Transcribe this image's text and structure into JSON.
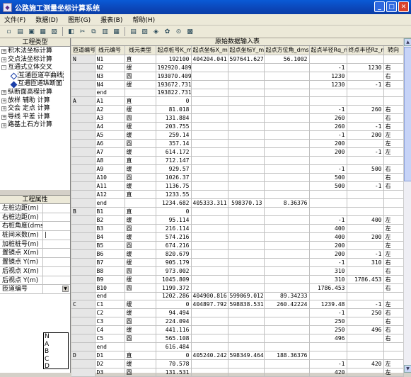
{
  "window": {
    "title": "公路施工测量坐标计算系统"
  },
  "menu": [
    "文件(F)",
    "数据(D)",
    "图形(G)",
    "报表(B)",
    "帮助(H)"
  ],
  "toolbar_icons": [
    "new-icon",
    "open-icon",
    "save-icon",
    "save-as-icon",
    "print-icon",
    "preview-icon",
    "cut-icon",
    "copy-icon",
    "paste-icon",
    "grid-icon",
    "table-icon",
    "chart-icon",
    "export-icon",
    "settings-icon",
    "info-icon",
    "calc-icon"
  ],
  "left": {
    "tree_header": "工程类型",
    "tree": [
      {
        "label": "积木法坐标计算",
        "exp": "+",
        "level": 0
      },
      {
        "label": "交点法坐标计算",
        "exp": "+",
        "level": 0
      },
      {
        "label": "互通式立体交叉",
        "exp": "-",
        "level": 0
      },
      {
        "label": "互通匝道平曲线",
        "exp": "",
        "level": 1,
        "sel": true
      },
      {
        "label": "互通匝道纵断面",
        "exp": "",
        "level": 1
      },
      {
        "label": "纵断面高程计算",
        "exp": "+",
        "level": 0
      },
      {
        "label": "放样 辅助 计算",
        "exp": "+",
        "level": 0
      },
      {
        "label": "交会 定点 计算",
        "exp": "+",
        "level": 0
      },
      {
        "label": "导线 平差 计算",
        "exp": "+",
        "level": 0
      },
      {
        "label": "路基土石方计算",
        "exp": "+",
        "level": 0
      }
    ],
    "props_header": "工程属性",
    "props": [
      {
        "name": "左桩边距(m)",
        "value": ""
      },
      {
        "name": "右桩边距(m)",
        "value": ""
      },
      {
        "name": "右桩角度(dms)",
        "value": ""
      },
      {
        "name": "桩间米数(m)",
        "value": "|"
      },
      {
        "name": "加桩桩号(m)",
        "value": ""
      },
      {
        "name": "置镜点 X(m)",
        "value": ""
      },
      {
        "name": "置镜点 Y(m)",
        "value": ""
      },
      {
        "name": "后视点 X(m)",
        "value": ""
      },
      {
        "name": "后视点 Y(m)",
        "value": ""
      },
      {
        "name": "匝道编号",
        "value": ""
      }
    ],
    "dropdown_options": [
      "N",
      "A",
      "B",
      "C",
      "D"
    ]
  },
  "table": {
    "title": "原始数据输入表",
    "columns": [
      "匝道编号",
      "线元编号",
      "线元类型",
      "起点桩号K_m",
      "起点坐标X_m",
      "起点坐标Y_m",
      "起点方位角_dms",
      "起点半径Rq_m",
      "终点半径Rz_m",
      "转向"
    ],
    "rows": [
      [
        "N",
        "N1",
        "直",
        "192100",
        "404204.041",
        "597641.627",
        "56.1002",
        "",
        "",
        ""
      ],
      [
        "",
        "N2",
        "缓",
        "192920.409",
        "",
        "",
        "",
        "-1",
        "1230",
        "右"
      ],
      [
        "",
        "N3",
        "圆",
        "193070.409",
        "",
        "",
        "",
        "1230",
        "",
        "右"
      ],
      [
        "",
        "N4",
        "缓",
        "193672.731",
        "",
        "",
        "",
        "1230",
        "-1",
        "右"
      ],
      [
        "",
        "end",
        "",
        "193822.731",
        "",
        "",
        "",
        "",
        "",
        ""
      ],
      [
        "A",
        "A1",
        "直",
        "0",
        "",
        "",
        "",
        "",
        "",
        ""
      ],
      [
        "",
        "A2",
        "缓",
        "81.018",
        "",
        "",
        "",
        "-1",
        "260",
        "右"
      ],
      [
        "",
        "A3",
        "圆",
        "131.884",
        "",
        "",
        "",
        "260",
        "",
        "右"
      ],
      [
        "",
        "A4",
        "缓",
        "203.755",
        "",
        "",
        "",
        "260",
        "-1",
        "右"
      ],
      [
        "",
        "A5",
        "缓",
        "259.14",
        "",
        "",
        "",
        "-1",
        "200",
        "左"
      ],
      [
        "",
        "A6",
        "圆",
        "357.14",
        "",
        "",
        "",
        "200",
        "",
        "左"
      ],
      [
        "",
        "A7",
        "缓",
        "614.172",
        "",
        "",
        "",
        "200",
        "-1",
        "左"
      ],
      [
        "",
        "A8",
        "直",
        "712.147",
        "",
        "",
        "",
        "",
        "",
        ""
      ],
      [
        "",
        "A9",
        "缓",
        "929.57",
        "",
        "",
        "",
        "-1",
        "500",
        "右"
      ],
      [
        "",
        "A10",
        "圆",
        "1026.37",
        "",
        "",
        "",
        "500",
        "",
        "右"
      ],
      [
        "",
        "A11",
        "缓",
        "1136.75",
        "",
        "",
        "",
        "500",
        "-1",
        "右"
      ],
      [
        "",
        "A12",
        "直",
        "1233.55",
        "",
        "",
        "",
        "",
        "",
        ""
      ],
      [
        "",
        "end",
        "",
        "1234.682",
        "405333.311",
        "598370.13",
        "8.36376",
        "",
        "",
        ""
      ],
      [
        "B",
        "B1",
        "直",
        "0",
        "",
        "",
        "",
        "",
        "",
        ""
      ],
      [
        "",
        "B2",
        "缓",
        "95.114",
        "",
        "",
        "",
        "-1",
        "400",
        "左"
      ],
      [
        "",
        "B3",
        "圆",
        "216.114",
        "",
        "",
        "",
        "400",
        "",
        "左"
      ],
      [
        "",
        "B4",
        "缓",
        "574.216",
        "",
        "",
        "",
        "400",
        "200",
        "左"
      ],
      [
        "",
        "B5",
        "圆",
        "674.216",
        "",
        "",
        "",
        "200",
        "",
        "左"
      ],
      [
        "",
        "B6",
        "缓",
        "820.679",
        "",
        "",
        "",
        "200",
        "-1",
        "左"
      ],
      [
        "",
        "B7",
        "缓",
        "905.179",
        "",
        "",
        "",
        "-1",
        "310",
        "右"
      ],
      [
        "",
        "B8",
        "圆",
        "973.002",
        "",
        "",
        "",
        "310",
        "",
        "右"
      ],
      [
        "",
        "B9",
        "缓",
        "1045.809",
        "",
        "",
        "",
        "310",
        "1786.453",
        "右"
      ],
      [
        "",
        "B10",
        "圆",
        "1199.372",
        "",
        "",
        "",
        "1786.453",
        "",
        "右"
      ],
      [
        "",
        "end",
        "",
        "1202.286",
        "404900.816",
        "599069.012",
        "89.34233",
        "",
        "",
        ""
      ],
      [
        "C",
        "C1",
        "缓",
        "0",
        "404897.792",
        "598838.531",
        "260.42224",
        "1239.48",
        "-1",
        "左"
      ],
      [
        "",
        "C2",
        "缓",
        "94.494",
        "",
        "",
        "",
        "-1",
        "250",
        "右"
      ],
      [
        "",
        "C3",
        "圆",
        "224.094",
        "",
        "",
        "",
        "250",
        "",
        "右"
      ],
      [
        "",
        "C4",
        "缓",
        "441.116",
        "",
        "",
        "",
        "250",
        "496",
        "右"
      ],
      [
        "",
        "C5",
        "圆",
        "565.108",
        "",
        "",
        "",
        "496",
        "",
        "右"
      ],
      [
        "",
        "end",
        "",
        "616.484",
        "",
        "",
        "",
        "",
        "",
        ""
      ],
      [
        "D",
        "D1",
        "直",
        "0",
        "405240.242",
        "598349.464",
        "188.36376",
        "",
        "",
        ""
      ],
      [
        "",
        "D2",
        "缓",
        "70.578",
        "",
        "",
        "",
        "-1",
        "420",
        "左"
      ],
      [
        "",
        "D3",
        "圆",
        "131.531",
        "",
        "",
        "",
        "420",
        "",
        "左"
      ]
    ]
  }
}
